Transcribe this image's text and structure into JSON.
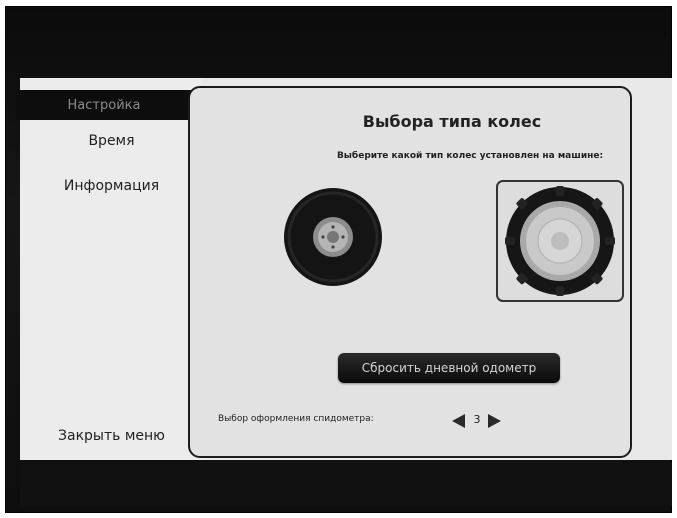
{
  "sidebar": {
    "active_label": "Настройка",
    "items": [
      {
        "label": "Время"
      },
      {
        "label": "Информация"
      }
    ],
    "close_label": "Закрыть меню"
  },
  "main": {
    "title": "Выбора типа колес",
    "subtitle": "Выберите какой тип колес установлен на машине:",
    "wheel_options": [
      {
        "icon": "small-wheel-icon",
        "selected": false
      },
      {
        "icon": "large-wheel-icon",
        "selected": true
      }
    ],
    "reset_button_label": "Сбросить дневной одометр",
    "speedometer": {
      "label": "Выбор оформления спидометра:",
      "value": "3"
    }
  }
}
